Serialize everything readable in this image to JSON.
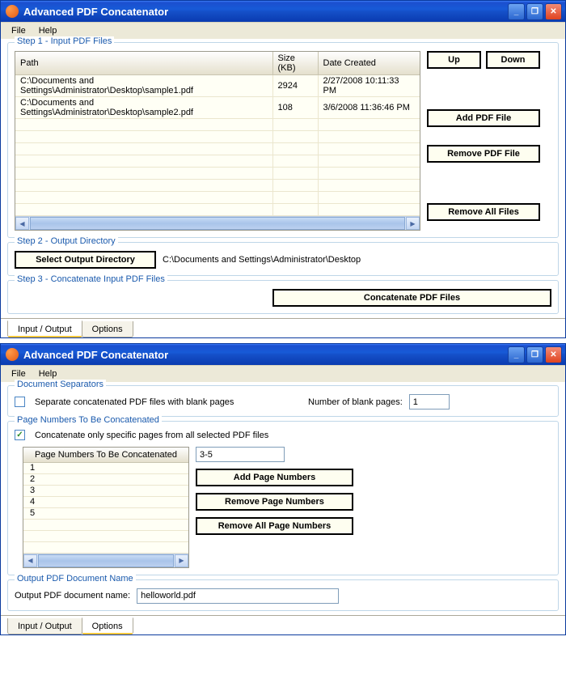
{
  "app": {
    "title": "Advanced PDF Concatenator"
  },
  "menu": {
    "file": "File",
    "help": "Help"
  },
  "window1": {
    "step1_label": "Step 1 - Input PDF Files",
    "cols": {
      "path": "Path",
      "size": "Size (KB)",
      "date": "Date Created"
    },
    "rows": [
      {
        "path": "C:\\Documents and Settings\\Administrator\\Desktop\\sample1.pdf",
        "size": "2924",
        "date": "2/27/2008 10:11:33 PM"
      },
      {
        "path": "C:\\Documents and Settings\\Administrator\\Desktop\\sample2.pdf",
        "size": "108",
        "date": "3/6/2008 11:36:46 PM"
      }
    ],
    "btn_up": "Up",
    "btn_down": "Down",
    "btn_add": "Add PDF File",
    "btn_remove": "Remove PDF File",
    "btn_remove_all": "Remove All Files",
    "step2_label": "Step 2 - Output Directory",
    "btn_select_dir": "Select Output Directory",
    "out_dir": "C:\\Documents and Settings\\Administrator\\Desktop",
    "step3_label": "Step 3 - Concatenate Input PDF Files",
    "btn_concat": "Concatenate PDF Files",
    "tab_io": "Input / Output",
    "tab_opt": "Options"
  },
  "window2": {
    "sep_label": "Document Separators",
    "sep_check": "Separate concatenated PDF files with blank pages",
    "sep_num_label": "Number of blank pages:",
    "sep_num_val": "1",
    "pn_label": "Page Numbers To Be Concatenated",
    "pn_check": "Concatenate only specific pages from all selected PDF files",
    "pn_col": "Page Numbers To Be Concatenated",
    "pn_rows": [
      "1",
      "2",
      "3",
      "4",
      "5"
    ],
    "pn_input": "3-5",
    "btn_add_pn": "Add Page Numbers",
    "btn_rem_pn": "Remove Page Numbers",
    "btn_rem_all_pn": "Remove All Page Numbers",
    "outdoc_label": "Output PDF Document Name",
    "outdoc_field_label": "Output PDF document name:",
    "outdoc_val": "helloworld.pdf",
    "tab_io": "Input / Output",
    "tab_opt": "Options"
  }
}
